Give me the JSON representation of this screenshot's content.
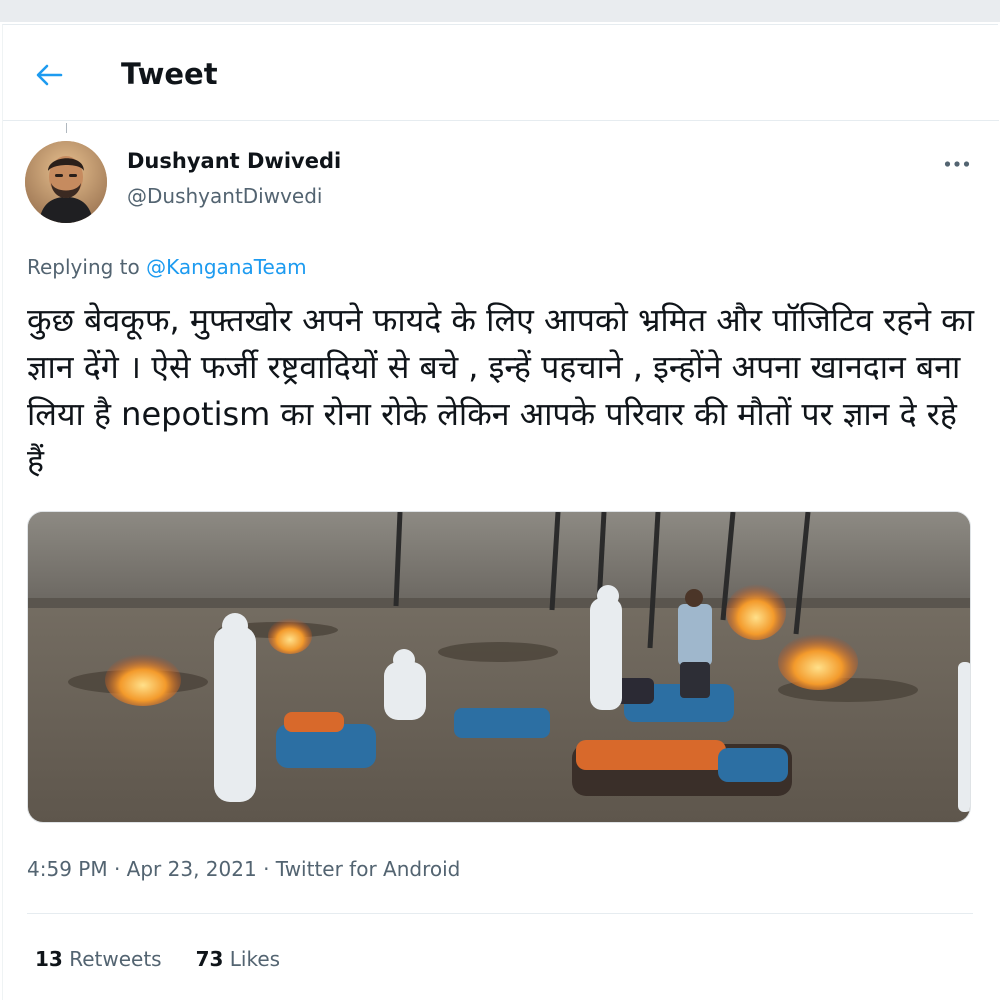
{
  "header": {
    "title": "Tweet",
    "back_icon": "arrow-left-icon",
    "accent_color": "#1d9bf0"
  },
  "tweet": {
    "author": {
      "name": "Dushyant Dwivedi",
      "handle": "@DushyantDiwvedi"
    },
    "more_icon": "more-horizontal-icon",
    "replying_prefix": "Replying to",
    "replying_to": "@KanganaTeam",
    "text": "कुछ बेवकूफ, मुफ्तखोर अपने फायदे के लिए आपको भ्रमित और पॉजिटिव रहने का ज्ञान देंगे । ऐसे फर्जी रष्ट्रवादियों से बचे , इन्हें पहचाने , इन्होंने अपना खानदान बना लिया है nepotism का रोना रोके लेकिन आपके परिवार की मौतों पर ज्ञान दे रहे हैं",
    "time": "4:59 PM",
    "date": "Apr 23, 2021",
    "source": "Twitter for Android",
    "retweets_count": "13",
    "retweets_label": "Retweets",
    "likes_count": "73",
    "likes_label": "Likes"
  }
}
